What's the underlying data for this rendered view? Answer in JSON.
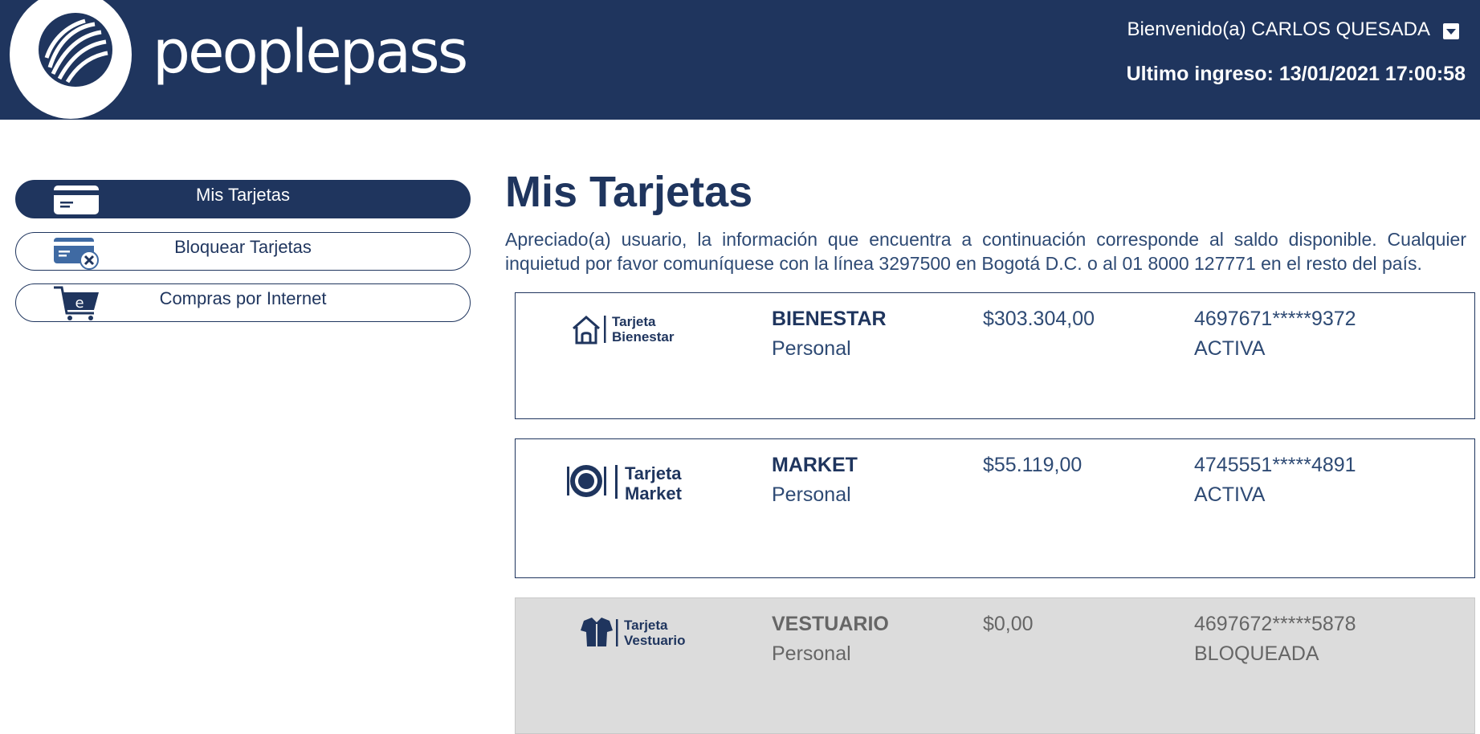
{
  "header": {
    "brand": "peoplepass",
    "welcome": "Bienvenido(a) CARLOS QUESADA",
    "last_login": "Ultimo ingreso: 13/01/2021 17:00:58"
  },
  "sidebar": {
    "items": [
      {
        "label": "Mis Tarjetas",
        "icon": "card-icon",
        "active": true
      },
      {
        "label": "Bloquear Tarjetas",
        "icon": "card-block-icon",
        "active": false
      },
      {
        "label": "Compras por Internet",
        "icon": "shopping-cart-icon",
        "active": false
      }
    ]
  },
  "main": {
    "title": "Mis Tarjetas",
    "intro": "Apreciado(a) usuario, la información que encuentra a continuación corresponde al saldo disponible. Cualquier inquietud por favor comuníquese con la línea 3297500 en Bogotá D.C. o al 01 8000 127771 en el resto del país.",
    "cards": [
      {
        "logo_line1": "Tarjeta",
        "logo_line2": "Bienestar",
        "logo_icon": "house-icon",
        "name": "BIENESTAR",
        "type": "Personal",
        "balance": "$303.304,00",
        "number": "4697671*****9372",
        "status": "ACTIVA"
      },
      {
        "logo_line1": "Tarjeta",
        "logo_line2": "Market",
        "logo_icon": "plate-icon",
        "name": "MARKET",
        "type": "Personal",
        "balance": "$55.119,00",
        "number": "4745551*****4891",
        "status": "ACTIVA"
      },
      {
        "logo_line1": "Tarjeta",
        "logo_line2": "Vestuario",
        "logo_icon": "shirt-icon",
        "name": "VESTUARIO",
        "type": "Personal",
        "balance": "$0,00",
        "number": "4697672*****5878",
        "status": "BLOQUEADA"
      }
    ]
  },
  "colors": {
    "primary": "#1f355e",
    "blocked_bg": "#dcdcdc",
    "white": "#ffffff"
  }
}
